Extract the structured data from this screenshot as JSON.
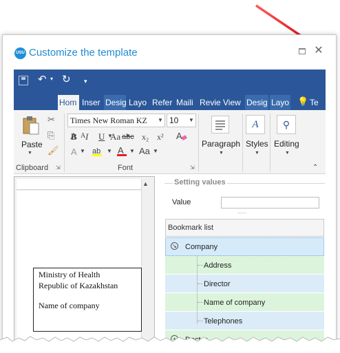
{
  "dialog": {
    "title": "Customize the template",
    "logo_text": "USU"
  },
  "quick_access": {
    "more": "▾"
  },
  "tabs": [
    {
      "label": "Hom",
      "active": true
    },
    {
      "label": "Inser"
    },
    {
      "label": "Desig",
      "contextual": true
    },
    {
      "label": "Layo"
    },
    {
      "label": "Refer"
    },
    {
      "label": "Maili"
    },
    {
      "label": "Revie"
    },
    {
      "label": "View"
    },
    {
      "label": "Desig",
      "contextual": true
    },
    {
      "label": "Layo",
      "contextual": true
    },
    {
      "label": "Te"
    }
  ],
  "ribbon": {
    "clipboard": {
      "paste": "Paste",
      "group_label": "Clipboard"
    },
    "font": {
      "font_name": "Times New Roman KZ",
      "font_size": "10",
      "grow": "A",
      "shrink": "A",
      "bold": "B",
      "italic": "I",
      "underline": "U",
      "strikethrough": "abc",
      "subscript": "x₂",
      "superscript": "x²",
      "clear_format": "A",
      "font_color": "A",
      "change_case": "Aa",
      "group_label": "Font"
    },
    "paragraph": "Paragraph",
    "styles": "Styles",
    "styles_glyph": "A",
    "editing": "Editing"
  },
  "document": {
    "lines": [
      "Ministry of Health",
      "Republic of Kazakhstan",
      "",
      "Name of company"
    ]
  },
  "settings": {
    "group_title": "Setting values",
    "value_label": "Value",
    "value": "",
    "splitter": "......"
  },
  "bookmarks": {
    "header": "Bookmark list",
    "items": [
      {
        "label": "Company",
        "level": 0,
        "expanded": true
      },
      {
        "label": "Address",
        "level": 1
      },
      {
        "label": "Director",
        "level": 1
      },
      {
        "label": "Name of company",
        "level": 1
      },
      {
        "label": "Telephones",
        "level": 1
      },
      {
        "label": "Doctor",
        "level": 0
      }
    ]
  },
  "colors": {
    "word_blue": "#2b579a",
    "title_blue": "#1e8bcf",
    "arrow_red": "#e31e24",
    "row_green": "#ddf4dc",
    "row_blue": "#dcebf8"
  }
}
